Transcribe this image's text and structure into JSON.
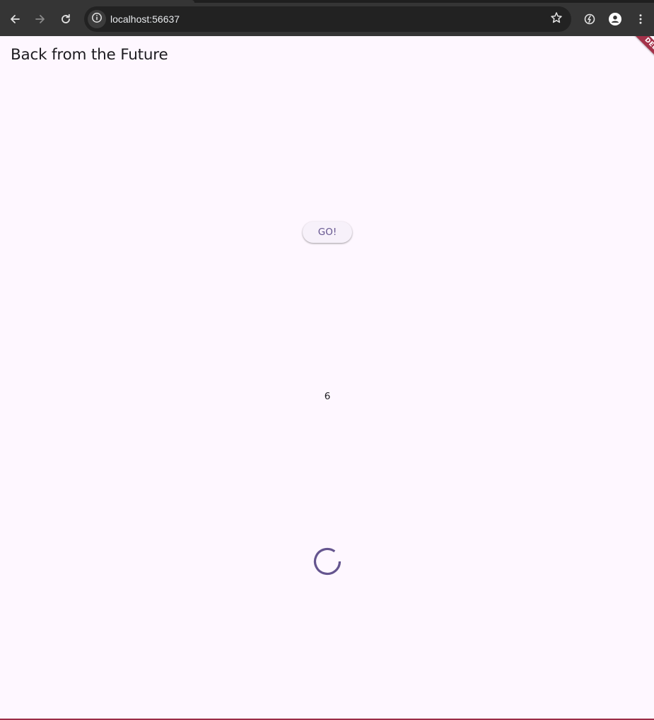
{
  "browser": {
    "url": "localhost:56637",
    "icons": {
      "back": "arrow-left-icon",
      "forward": "arrow-right-icon",
      "reload": "reload-icon",
      "site_info": "info-icon",
      "bookmark": "star-icon",
      "extension": "extension-icon",
      "profile": "profile-icon",
      "menu": "kebab-menu-icon"
    }
  },
  "app": {
    "title": "Back from the Future",
    "go_button_label": "GO!",
    "result_value": "6",
    "debug_banner": "DEBUG",
    "colors": {
      "background": "#fef7ff",
      "primary": "#65558f",
      "spinner": "#65558f",
      "debug_banner": "#a4324a"
    }
  }
}
